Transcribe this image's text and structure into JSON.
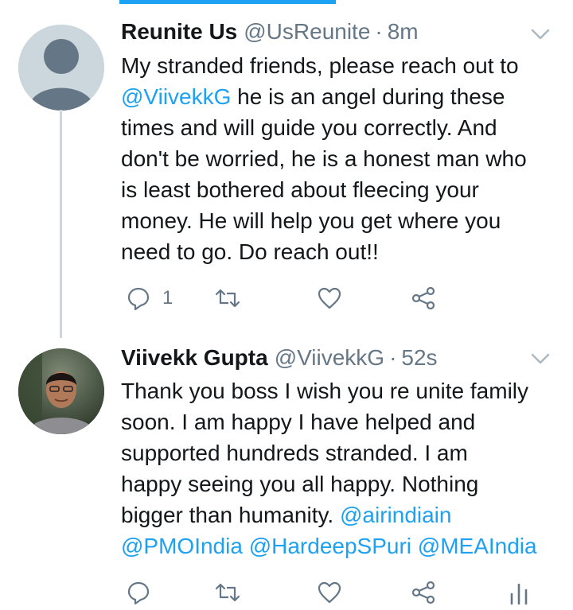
{
  "tweets": [
    {
      "name": "Reunite Us",
      "handle": "@UsReunite",
      "separator": "·",
      "time": "8m",
      "text_lines": [
        "My stranded friends, please reach out to",
        {
          "mention": "@ViivekkG",
          "rest": " he is an angel during these"
        },
        "times and will guide you correctly. And",
        "don't be worried, he is a honest man who",
        "is least bothered about fleecing your",
        "money. He will help you get where you",
        "need to go. Do reach out!!"
      ],
      "reply_count": "1"
    },
    {
      "name": "Viivekk Gupta",
      "handle": "@ViivekkG",
      "separator": "·",
      "time": "52s",
      "text_lines": [
        "Thank you boss I wish you re unite family",
        "soon. I am happy I have helped and",
        "supported hundreds stranded. I am",
        "happy seeing you all happy. Nothing",
        "bigger than humanity.",
        "@PMOIndia @HardeepSPuri @MEAIndia"
      ],
      "mention_line5": "@airindiain"
    }
  ],
  "icons": {
    "reply": "reply-icon",
    "retweet": "retweet-icon",
    "like": "heart-icon",
    "share": "share-icon",
    "analytics": "analytics-icon",
    "caret": "chevron-down-icon",
    "avatar_default": "default-avatar-icon"
  },
  "colors": {
    "accent": "#1da1f2",
    "secondary_text": "#657786",
    "primary_text": "#14171a",
    "thread_line": "#ccd6dd"
  }
}
